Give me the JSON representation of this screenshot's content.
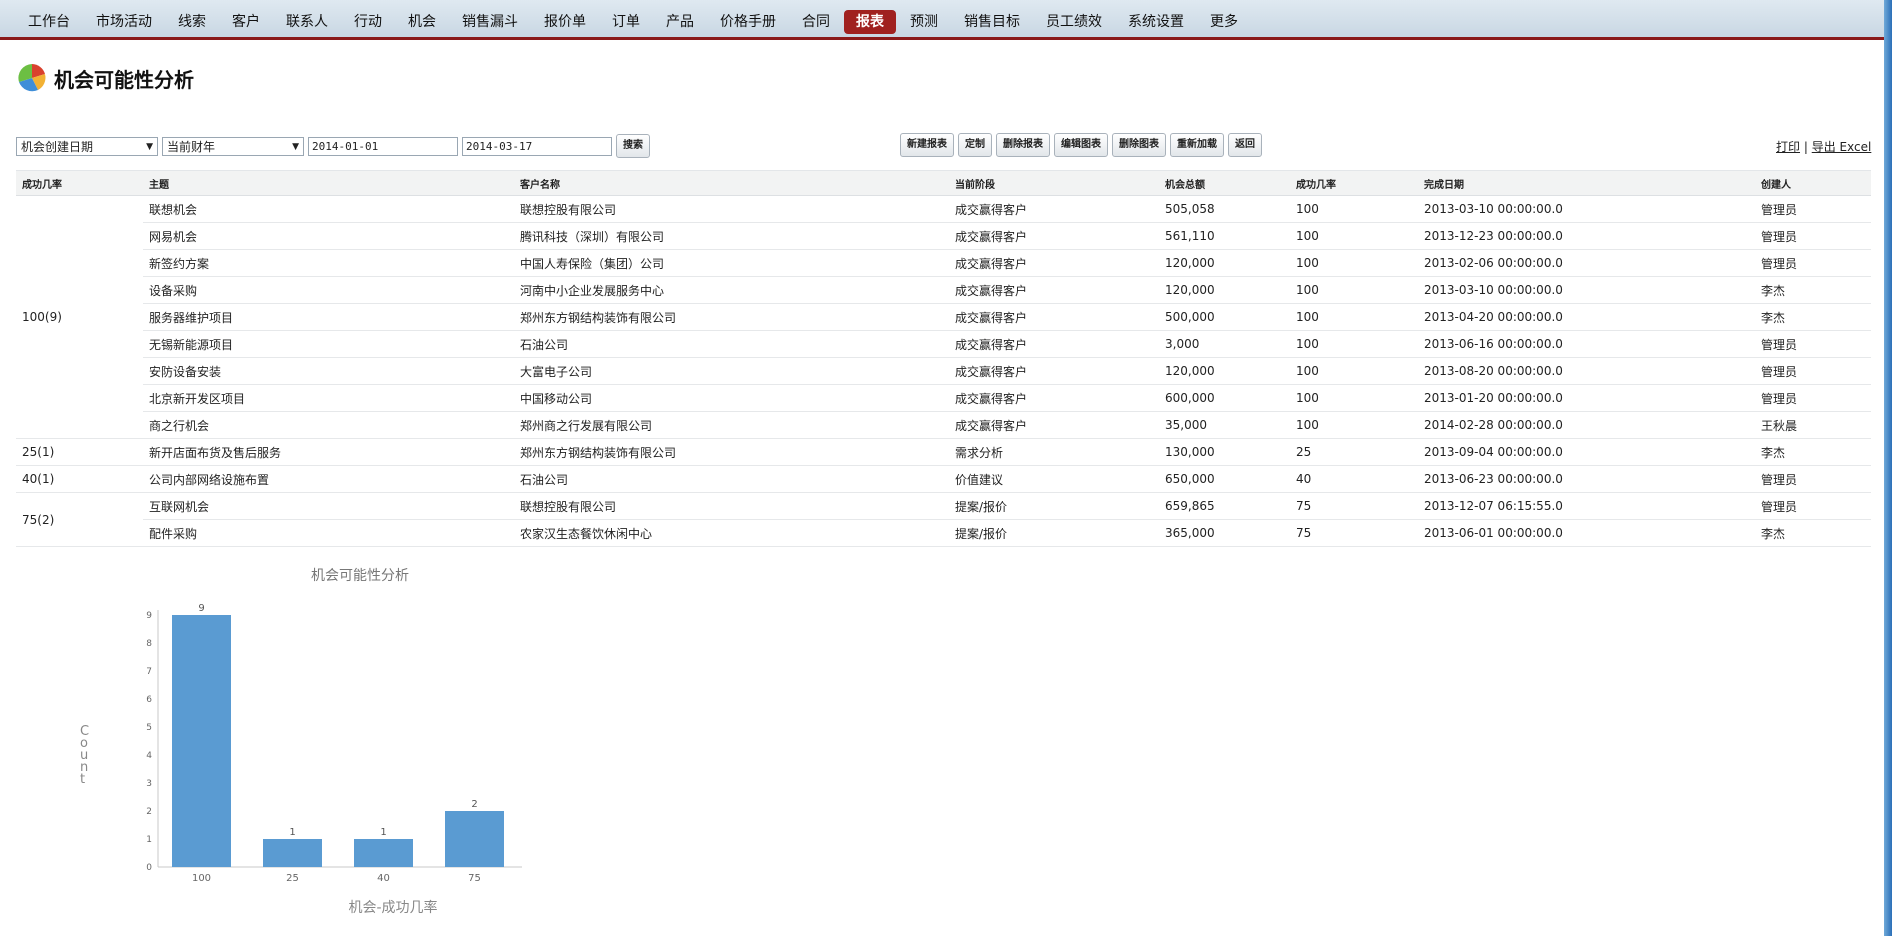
{
  "nav": {
    "items": [
      "工作台",
      "市场活动",
      "线索",
      "客户",
      "联系人",
      "行动",
      "机会",
      "销售漏斗",
      "报价单",
      "订单",
      "产品",
      "价格手册",
      "合同",
      "报表",
      "预测",
      "销售目标",
      "员工绩效",
      "系统设置",
      "更多"
    ],
    "active_index": 13
  },
  "page": {
    "title": "机会可能性分析"
  },
  "filters": {
    "date_field": "机会创建日期",
    "period": "当前财年",
    "start_date": "2014-01-01",
    "end_date": "2014-03-17",
    "search_label": "搜索"
  },
  "actions": [
    "新建报表",
    "定制",
    "删除报表",
    "编辑图表",
    "删除图表",
    "重新加载",
    "返回"
  ],
  "links": {
    "print": "打印",
    "separator": "|",
    "export": "导出 Excel"
  },
  "table": {
    "headers": [
      "成功几率",
      "主题",
      "客户名称",
      "当前阶段",
      "机会总额",
      "成功几率",
      "完成日期",
      "创建人"
    ],
    "groups": [
      {
        "label": "100(9)",
        "rows": [
          [
            "联想机会",
            "联想控股有限公司",
            "成交赢得客户",
            "505,058",
            "100",
            "2013-03-10 00:00:00.0",
            "管理员"
          ],
          [
            "网易机会",
            "腾讯科技（深圳）有限公司",
            "成交赢得客户",
            "561,110",
            "100",
            "2013-12-23 00:00:00.0",
            "管理员"
          ],
          [
            "新签约方案",
            "中国人寿保险（集团）公司",
            "成交赢得客户",
            "120,000",
            "100",
            "2013-02-06 00:00:00.0",
            "管理员"
          ],
          [
            "设备采购",
            "河南中小企业发展服务中心",
            "成交赢得客户",
            "120,000",
            "100",
            "2013-03-10 00:00:00.0",
            "李杰"
          ],
          [
            "服务器维护项目",
            "郑州东方钢结构装饰有限公司",
            "成交赢得客户",
            "500,000",
            "100",
            "2013-04-20 00:00:00.0",
            "李杰"
          ],
          [
            "无锡新能源项目",
            "石油公司",
            "成交赢得客户",
            "3,000",
            "100",
            "2013-06-16 00:00:00.0",
            "管理员"
          ],
          [
            "安防设备安装",
            "大富电子公司",
            "成交赢得客户",
            "120,000",
            "100",
            "2013-08-20 00:00:00.0",
            "管理员"
          ],
          [
            "北京新开发区项目",
            "中国移动公司",
            "成交赢得客户",
            "600,000",
            "100",
            "2013-01-20 00:00:00.0",
            "管理员"
          ],
          [
            "商之行机会",
            "郑州商之行发展有限公司",
            "成交赢得客户",
            "35,000",
            "100",
            "2014-02-28 00:00:00.0",
            "王秋晨"
          ]
        ]
      },
      {
        "label": "25(1)",
        "rows": [
          [
            "新开店面布货及售后服务",
            "郑州东方钢结构装饰有限公司",
            "需求分析",
            "130,000",
            "25",
            "2013-09-04 00:00:00.0",
            "李杰"
          ]
        ]
      },
      {
        "label": "40(1)",
        "rows": [
          [
            "公司内部网络设施布置",
            "石油公司",
            "价值建议",
            "650,000",
            "40",
            "2013-06-23 00:00:00.0",
            "管理员"
          ]
        ]
      },
      {
        "label": "75(2)",
        "rows": [
          [
            "互联网机会",
            "联想控股有限公司",
            "提案/报价",
            "659,865",
            "75",
            "2013-12-07 06:15:55.0",
            "管理员"
          ],
          [
            "配件采购",
            "农家汉生态餐饮休闲中心",
            "提案/报价",
            "365,000",
            "75",
            "2013-06-01 00:00:00.0",
            "李杰"
          ]
        ]
      }
    ]
  },
  "chart_data": {
    "type": "bar",
    "title": "机会可能性分析",
    "xlabel": "机会-成功几率",
    "ylabel": "Count",
    "categories": [
      "100",
      "25",
      "40",
      "75"
    ],
    "values": [
      9,
      1,
      1,
      2
    ],
    "ylim": [
      0,
      9
    ],
    "yticks": [
      0,
      1,
      2,
      3,
      4,
      5,
      6,
      7,
      8,
      9
    ],
    "color": "#5a9bd2",
    "grid": false
  }
}
